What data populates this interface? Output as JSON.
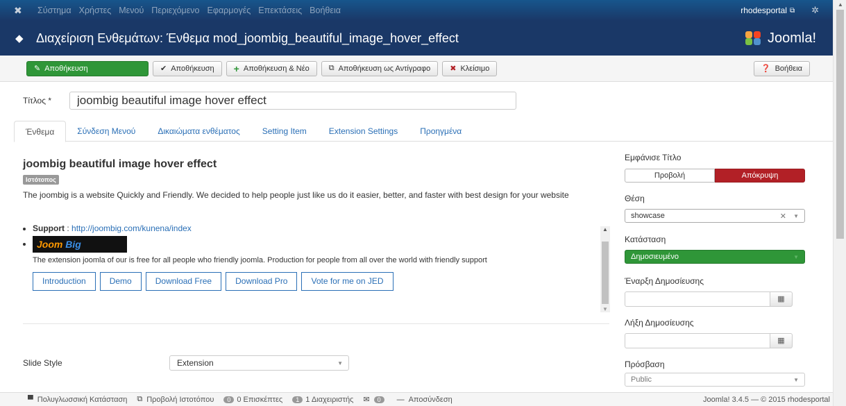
{
  "navbar": {
    "menu": [
      "Σύστημα",
      "Χρήστες",
      "Μενού",
      "Περιεχόμενο",
      "Εφαρμογές",
      "Επεκτάσεις",
      "Βοήθεια"
    ],
    "site_label": "rhodesportal"
  },
  "header": {
    "title": "Διαχείριση Ενθεμάτων: Ένθεμα mod_joombig_beautiful_image_hover_effect",
    "brand": "Joomla!"
  },
  "toolbar": {
    "save": "Αποθήκευση",
    "save_close": "Αποθήκευση",
    "save_new": "Αποθήκευση & Νέο",
    "save_copy": "Αποθήκευση ως Αντίγραφο",
    "close": "Κλείσιμο",
    "help": "Βοήθεια"
  },
  "title_field": {
    "label": "Τίτλος *",
    "value": "joombig beautiful image hover effect"
  },
  "tabs": [
    "Ένθεμα",
    "Σύνδεση Μενού",
    "Δικαιώματα ενθέματος",
    "Setting Item",
    "Extension Settings",
    "Προηγμένα"
  ],
  "module": {
    "heading": "joombig beautiful image hover effect",
    "badge": "Ιστότοπος",
    "description": "The joombig is a website Quickly and Friendly. We decided to help people just like us do it easier, better, and faster with best design for your website",
    "support_label": "Support",
    "support_link": "http://joombig.com/kunena/index",
    "logo_text_a": "Joom ",
    "logo_text_b": "Big",
    "free_text": "The extension joomla of our is free for all people who friendly joomla. Production for people from all over the world with friendly support",
    "link_buttons": [
      "Introduction",
      "Demo",
      "Download Free",
      "Download Pro",
      "Vote for me on JED"
    ]
  },
  "slide_style": {
    "label": "Slide Style",
    "value": "Extension"
  },
  "sidebar": {
    "show_title_label": "Εμφάνισε Τίτλο",
    "show": "Προβολή",
    "hide": "Απόκρυψη",
    "position_label": "Θέση",
    "position_value": "showcase",
    "status_label": "Κατάσταση",
    "status_value": "Δημοσιευμένο",
    "publish_up_label": "Έναρξη Δημοσίευσης",
    "publish_down_label": "Λήξη Δημοσίευσης",
    "access_label": "Πρόσβαση",
    "access_value": "Public"
  },
  "statusbar": {
    "multilang": "Πολυγλωσσική Κατάσταση",
    "view_site": "Προβολή Ιστοτόπου",
    "visitors_count": "0",
    "visitors": "0 Επισκέπτες",
    "admins_count": "1",
    "admins": "1 Διαχειριστής",
    "messages_count": "0",
    "logout": "Αποσύνδεση",
    "version": "Joomla! 3.4.5 — © 2015 rhodesportal"
  }
}
